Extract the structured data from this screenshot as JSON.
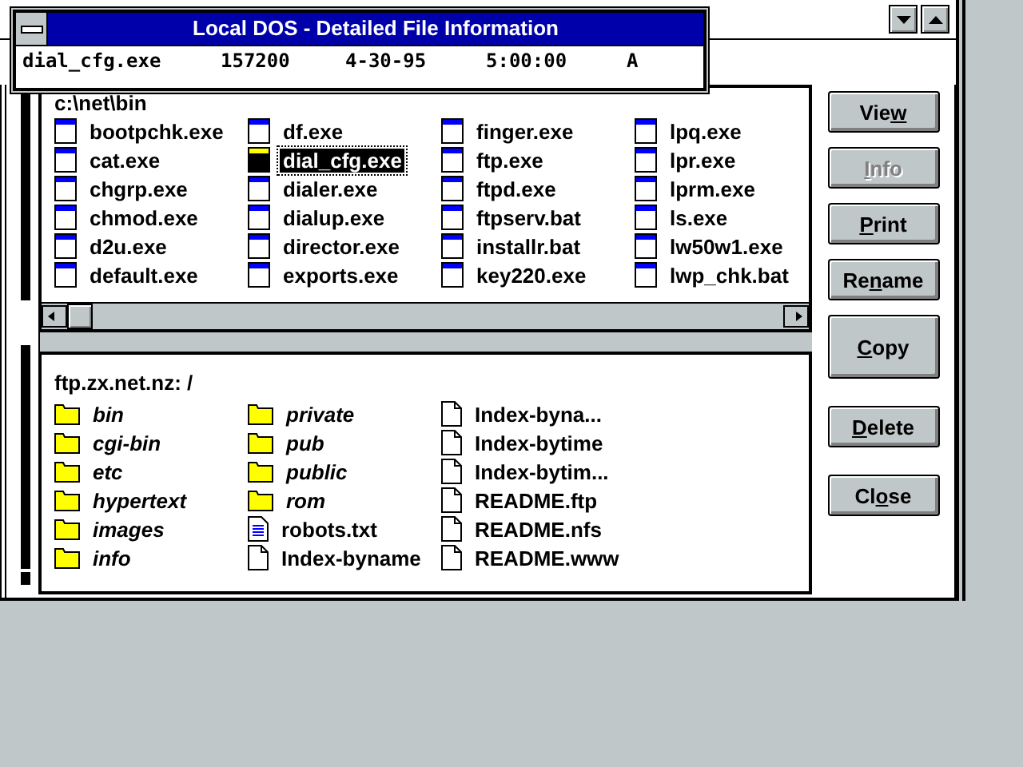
{
  "info_window": {
    "title": "Local DOS - Detailed File Information",
    "fields": [
      "dial_cfg.exe",
      "157200",
      "4-30-95",
      "5:00:00",
      "A"
    ]
  },
  "local_pane": {
    "path": "c:\\net\\bin",
    "files": [
      {
        "name": "bootpchk.exe",
        "selected": false
      },
      {
        "name": "cat.exe",
        "selected": false
      },
      {
        "name": "chgrp.exe",
        "selected": false
      },
      {
        "name": "chmod.exe",
        "selected": false
      },
      {
        "name": "d2u.exe",
        "selected": false
      },
      {
        "name": "default.exe",
        "selected": false
      },
      {
        "name": "df.exe",
        "selected": false
      },
      {
        "name": "dial_cfg.exe",
        "selected": true
      },
      {
        "name": "dialer.exe",
        "selected": false
      },
      {
        "name": "dialup.exe",
        "selected": false
      },
      {
        "name": "director.exe",
        "selected": false
      },
      {
        "name": "exports.exe",
        "selected": false
      },
      {
        "name": "finger.exe",
        "selected": false
      },
      {
        "name": "ftp.exe",
        "selected": false
      },
      {
        "name": "ftpd.exe",
        "selected": false
      },
      {
        "name": "ftpserv.bat",
        "selected": false
      },
      {
        "name": "installr.bat",
        "selected": false
      },
      {
        "name": "key220.exe",
        "selected": false
      },
      {
        "name": "lpq.exe",
        "selected": false
      },
      {
        "name": "lpr.exe",
        "selected": false
      },
      {
        "name": "lprm.exe",
        "selected": false
      },
      {
        "name": "ls.exe",
        "selected": false
      },
      {
        "name": "lw50w1.exe",
        "selected": false
      },
      {
        "name": "lwp_chk.bat",
        "selected": false
      }
    ]
  },
  "remote_pane": {
    "path": "ftp.zx.net.nz: /",
    "items": [
      {
        "name": "bin",
        "kind": "folder"
      },
      {
        "name": "cgi-bin",
        "kind": "folder"
      },
      {
        "name": "etc",
        "kind": "folder"
      },
      {
        "name": "hypertext",
        "kind": "folder"
      },
      {
        "name": "images",
        "kind": "folder"
      },
      {
        "name": "info",
        "kind": "folder"
      },
      {
        "name": "private",
        "kind": "folder"
      },
      {
        "name": "pub",
        "kind": "folder"
      },
      {
        "name": "public",
        "kind": "folder"
      },
      {
        "name": "rom",
        "kind": "folder"
      },
      {
        "name": "robots.txt",
        "kind": "text"
      },
      {
        "name": "Index-byname",
        "kind": "file"
      },
      {
        "name": "Index-byna...",
        "kind": "file"
      },
      {
        "name": "Index-bytime",
        "kind": "file"
      },
      {
        "name": "Index-bytim...",
        "kind": "file"
      },
      {
        "name": "README.ftp",
        "kind": "file"
      },
      {
        "name": "README.nfs",
        "kind": "file"
      },
      {
        "name": "README.www",
        "kind": "file"
      }
    ]
  },
  "buttons": [
    {
      "label": [
        {
          "text": "Vie",
          "underlined": false
        },
        {
          "text": "w",
          "underlined": true
        }
      ],
      "disabled": false
    },
    {
      "label": [
        {
          "text": "I",
          "underlined": true
        },
        {
          "text": "nfo",
          "underlined": false
        }
      ],
      "disabled": true
    },
    {
      "label": [
        {
          "text": "P",
          "underlined": true
        },
        {
          "text": "rint",
          "underlined": false
        }
      ],
      "disabled": false
    },
    {
      "label": [
        {
          "text": "Re",
          "underlined": false
        },
        {
          "text": "n",
          "underlined": true
        },
        {
          "text": "ame",
          "underlined": false
        }
      ],
      "disabled": false
    },
    {
      "label": [
        {
          "text": "C",
          "underlined": true
        },
        {
          "text": "opy",
          "underlined": false
        }
      ],
      "disabled": false
    },
    {
      "label": [
        {
          "text": "D",
          "underlined": true
        },
        {
          "text": "elete",
          "underlined": false
        }
      ],
      "disabled": false
    },
    {
      "label": [
        {
          "text": "Cl",
          "underlined": false
        },
        {
          "text": "o",
          "underlined": true
        },
        {
          "text": "se",
          "underlined": false
        }
      ],
      "disabled": false
    }
  ]
}
